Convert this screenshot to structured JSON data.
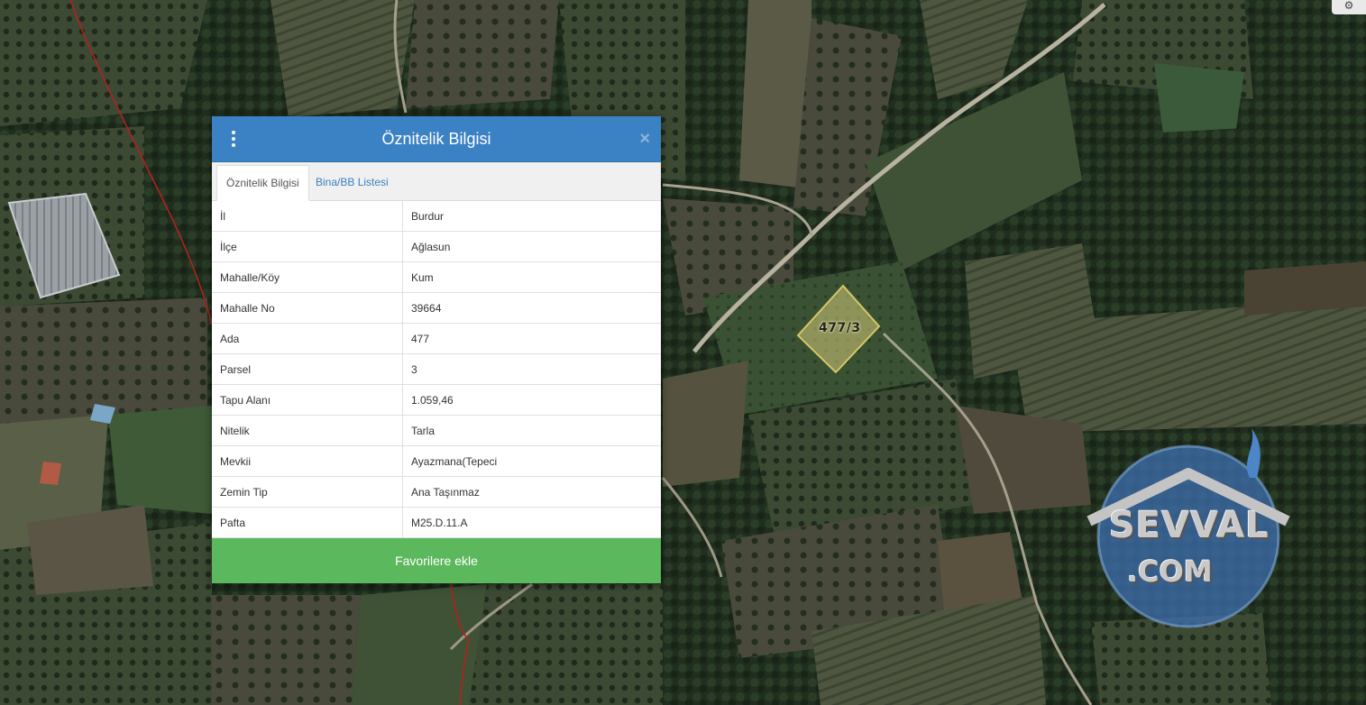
{
  "dialog": {
    "title": "Öznitelik Bilgisi",
    "close_symbol": "×",
    "menu_icon": "kebab-menu-icon",
    "header_color": "#3b82c4",
    "tabs": [
      {
        "label": "Öznitelik Bilgisi",
        "active": true
      },
      {
        "label": "Bina/BB Listesi",
        "active": false
      }
    ],
    "rows": [
      {
        "key": "İl",
        "value": "Burdur"
      },
      {
        "key": "İlçe",
        "value": "Ağlasun"
      },
      {
        "key": "Mahalle/Köy",
        "value": "Kum"
      },
      {
        "key": "Mahalle No",
        "value": "39664"
      },
      {
        "key": "Ada",
        "value": "477"
      },
      {
        "key": "Parsel",
        "value": "3"
      },
      {
        "key": "Tapu Alanı",
        "value": "1.059,46"
      },
      {
        "key": "Nitelik",
        "value": "Tarla"
      },
      {
        "key": "Mevkii",
        "value": "Ayazmana(Tepeci"
      },
      {
        "key": "Zemin Tip",
        "value": "Ana Taşınmaz"
      },
      {
        "key": "Pafta",
        "value": "M25.D.11.A"
      }
    ],
    "favorite_button": "Favorilere ekle",
    "favorite_color": "#5cb85c"
  },
  "map": {
    "parcel_label": "477/3",
    "watermark_line1": "SEVVAL",
    "watermark_line2": ".COM",
    "corner_icon": "gear-icon",
    "corner_symbol": "⚙"
  }
}
